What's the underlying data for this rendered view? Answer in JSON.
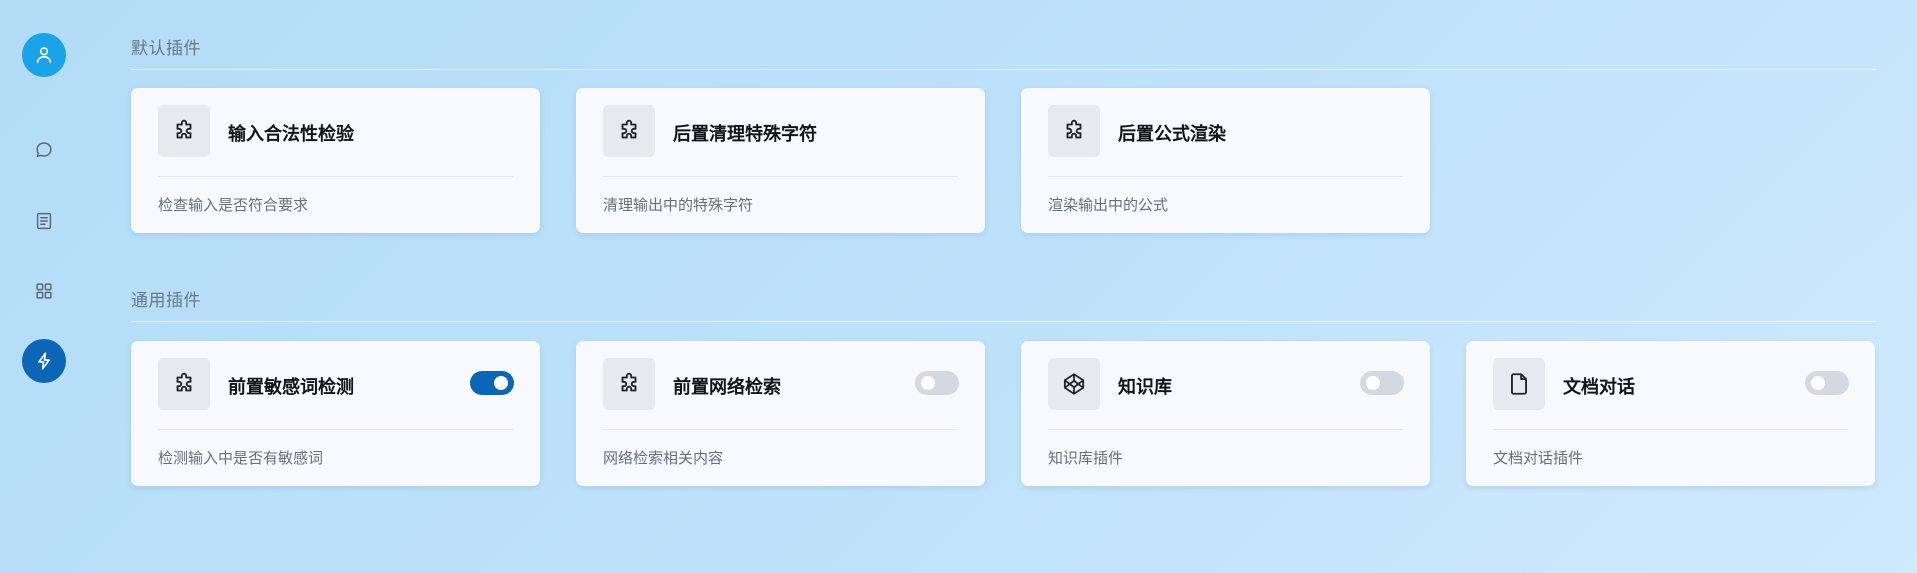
{
  "sidebar": {
    "items": [
      {
        "name": "avatar",
        "icon": "user-icon"
      },
      {
        "name": "chat",
        "icon": "chat-bubble-icon"
      },
      {
        "name": "docs",
        "icon": "document-icon"
      },
      {
        "name": "apps",
        "icon": "grid-icon"
      },
      {
        "name": "plugins",
        "icon": "lightning-icon",
        "active": true
      }
    ],
    "colors": {
      "avatar_bg": "#1ba3e8",
      "active_bg": "#0d66b5",
      "icon_color": "#5a6775"
    }
  },
  "sections": [
    {
      "title": "默认插件",
      "cards": [
        {
          "title": "输入合法性检验",
          "description": "检查输入是否符合要求",
          "icon": "puzzle-icon"
        },
        {
          "title": "后置清理特殊字符",
          "description": "清理输出中的特殊字符",
          "icon": "puzzle-icon"
        },
        {
          "title": "后置公式渲染",
          "description": "渲染输出中的公式",
          "icon": "puzzle-icon"
        }
      ]
    },
    {
      "title": "通用插件",
      "cards": [
        {
          "title": "前置敏感词检测",
          "description": "检测输入中是否有敏感词",
          "icon": "puzzle-icon",
          "enabled": true
        },
        {
          "title": "前置网络检索",
          "description": "网络检索相关内容",
          "icon": "puzzle-icon",
          "enabled": false
        },
        {
          "title": "知识库",
          "description": "知识库插件",
          "icon": "codepen-cube-icon",
          "enabled": false
        },
        {
          "title": "文档对话",
          "description": "文档对话插件",
          "icon": "file-icon",
          "enabled": false
        }
      ]
    }
  ],
  "theme": {
    "toggle_on": "#0d66b5",
    "toggle_off": "#d4d9e1"
  }
}
